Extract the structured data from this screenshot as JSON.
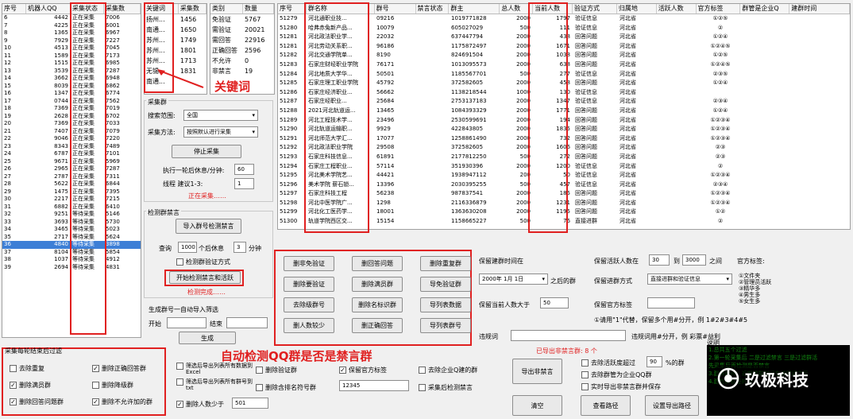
{
  "left_table": {
    "headers": [
      "序号",
      "机器人QQ",
      "采集状态",
      "采集数"
    ],
    "rows": [
      [
        "6",
        "4442",
        "正在采集",
        "7006"
      ],
      [
        "7",
        "4225",
        "正在采集",
        "6001"
      ],
      [
        "8",
        "1365",
        "正在采集",
        "6967"
      ],
      [
        "9",
        "7929",
        "正在采集",
        "7227"
      ],
      [
        "10",
        "4513",
        "正在采集",
        "7045"
      ],
      [
        "11",
        "1589",
        "正在采集",
        "7173"
      ],
      [
        "12",
        "1515",
        "正在采集",
        "6985"
      ],
      [
        "13",
        "3539",
        "正在采集",
        "7287"
      ],
      [
        "14",
        "3662",
        "正在采集",
        "6948"
      ],
      [
        "15",
        "8039",
        "正在采集",
        "6862"
      ],
      [
        "16",
        "1347",
        "正在采集",
        "6774"
      ],
      [
        "17",
        "0744",
        "正在采集",
        "7562"
      ],
      [
        "18",
        "7369",
        "正在采集",
        "7019"
      ],
      [
        "19",
        "2628",
        "正在采集",
        "6702"
      ],
      [
        "20",
        "7369",
        "正在采集",
        "7033"
      ],
      [
        "21",
        "7407",
        "正在采集",
        "7079"
      ],
      [
        "22",
        "9046",
        "正在采集",
        "7220"
      ],
      [
        "23",
        "8343",
        "正在采集",
        "7489"
      ],
      [
        "24",
        "6787",
        "正在采集",
        "7101"
      ],
      [
        "25",
        "9671",
        "正在采集",
        "5969"
      ],
      [
        "26",
        "2965",
        "正在采集",
        "7287"
      ],
      [
        "27",
        "2787",
        "正在采集",
        "7311"
      ],
      [
        "28",
        "5622",
        "正在采集",
        "6844"
      ],
      [
        "29",
        "1475",
        "正在采集",
        "7395"
      ],
      [
        "30",
        "2217",
        "正在采集",
        "7215"
      ],
      [
        "31",
        "6882",
        "正在采集",
        "6410"
      ],
      [
        "32",
        "9251",
        "等待采集",
        "5146"
      ],
      [
        "33",
        "3693",
        "等待采集",
        "5730"
      ],
      [
        "34",
        "3465",
        "等待采集",
        "5023"
      ],
      [
        "35",
        "2717",
        "等待采集",
        "5624"
      ],
      [
        "36",
        "4840",
        "等待采集",
        "3898"
      ],
      [
        "37",
        "8104",
        "等待采集",
        "5854"
      ],
      [
        "38",
        "1037",
        "等待采集",
        "4912"
      ],
      [
        "39",
        "2694",
        "等待采集",
        "4831"
      ]
    ]
  },
  "kw_table": {
    "headers": [
      "关键词",
      "采集数"
    ],
    "rows": [
      [
        "扬州...",
        "1456"
      ],
      [
        "南通...",
        "1650"
      ],
      [
        "苏州...",
        "1749"
      ],
      [
        "苏州...",
        "1801"
      ],
      [
        "苏州...",
        "1713"
      ],
      [
        "无锡...",
        "1831"
      ],
      [
        "南通...",
        ""
      ]
    ]
  },
  "cat_table": {
    "headers": [
      "类别",
      "数量"
    ],
    "rows": [
      [
        "免验证",
        "5767"
      ],
      [
        "需验证",
        "20021"
      ],
      [
        "需回答",
        "22916"
      ],
      [
        "正确回答",
        "2596"
      ],
      [
        "不允许",
        "0"
      ],
      [
        "非禁言",
        "19"
      ]
    ]
  },
  "annot": {
    "keyword": "关键词",
    "auto_detect": "自动检测QQ群是否是禁言群"
  },
  "collect": {
    "title": "采集群",
    "range_label": "搜索范围:",
    "range_value": "全国",
    "method_label": "采集方法:",
    "method_value": "按照默认进行采集",
    "stop_btn": "停止采集",
    "rest_label": "执行一轮后休息/分钟:",
    "rest_value": "60",
    "thread_label": "线程 建议1-3:",
    "thread_value": "1",
    "status": "正在采集……"
  },
  "detect": {
    "title": "检测群禁言",
    "import_btn": "导入群号检测禁言",
    "query_label": "查询",
    "query_value": "1000",
    "per_label": "个后休息",
    "rest_value": "3",
    "min_label": "分钟",
    "verify_cb": "检测群验证方式",
    "start_btn": "开始检测禁言和活跃",
    "status": "检测完成……"
  },
  "gen": {
    "title": "生成群号一自动导入筛选",
    "start_label": "开始",
    "end_label": "结束",
    "gen_btn": "生成"
  },
  "main_table": {
    "headers": [
      "序号",
      "群名称",
      "群号",
      "禁言状态",
      "群主",
      "总人数",
      "当前人数",
      "验证方式",
      "归属地",
      "活跃人数",
      "官方标签",
      "群管是企业Q",
      "建群时间"
    ],
    "rows": [
      [
        "51279",
        "河北通职业技...",
        "09216",
        "",
        "1019771828",
        "2000",
        "1797",
        "验证信息",
        "河北省",
        "",
        "①②⑤",
        ""
      ],
      [
        "51280",
        "哈弗赤兔新产品...",
        "10079",
        "",
        "605027029",
        "500",
        "111",
        "验证信息",
        "河北省",
        "",
        "②",
        ""
      ],
      [
        "51281",
        "河北政法职业学...",
        "22032",
        "",
        "637447794",
        "2000",
        "438",
        "回答问题",
        "河北省",
        "",
        "①②④",
        ""
      ],
      [
        "51281",
        "河北劳动关系职...",
        "96186",
        "",
        "1175872497",
        "2000",
        "1671",
        "回答问题",
        "河北省",
        "",
        "①②④⑤",
        ""
      ],
      [
        "51282",
        "河北交通学院单...",
        "8190",
        "",
        "824691504",
        "2000",
        "1038",
        "回答问题",
        "河北省",
        "",
        "①②⑤",
        ""
      ],
      [
        "51283",
        "石家庄财经职业学院",
        "76171",
        "",
        "1013095573",
        "2000",
        "638",
        "回答问题",
        "河北省",
        "",
        "①②④⑤",
        ""
      ],
      [
        "51284",
        "河北地质大学华...",
        "50501",
        "",
        "1185567701",
        "500",
        "277",
        "验证信息",
        "河北省",
        "",
        "②③⑤",
        ""
      ],
      [
        "51285",
        "石家庄理工职业学院",
        "45792",
        "",
        "372582605",
        "2000",
        "458",
        "回答问题",
        "河北省",
        "",
        "①②④",
        ""
      ],
      [
        "51286",
        "石家庄经济职业...",
        "56662",
        "",
        "1138218544",
        "1000",
        "130",
        "验证信息",
        "河北省",
        "",
        "",
        ""
      ],
      [
        "51287",
        "石家庄经职业...",
        "25684",
        "",
        "2753137183",
        "2000",
        "1347",
        "验证信息",
        "河北省",
        "",
        "②③④",
        ""
      ],
      [
        "51288",
        "2021河北轨道运...",
        "13465",
        "",
        "1084393329",
        "2000",
        "1771",
        "回答问题",
        "河北省",
        "",
        "①②④",
        ""
      ],
      [
        "51289",
        "河北工程技术学...",
        "23496",
        "",
        "2530599691",
        "2000",
        "194",
        "回答问题",
        "河北省",
        "",
        "①②③④",
        ""
      ],
      [
        "51290",
        "河北轨道运输职...",
        "9929",
        "",
        "422843805",
        "2000",
        "1835",
        "回答问题",
        "河北省",
        "",
        "①②③④",
        ""
      ],
      [
        "51291",
        "河北师范大学汇...",
        "17077",
        "",
        "1258861490",
        "2000",
        "732",
        "回答问题",
        "河北省",
        "",
        "①②③④",
        ""
      ],
      [
        "51292",
        "河北政法职业学院",
        "29508",
        "",
        "372582605",
        "2000",
        "1606",
        "回答问题",
        "河北省",
        "",
        "②③",
        ""
      ],
      [
        "51293",
        "石家庄科技信息...",
        "61891",
        "",
        "2177812250",
        "500",
        "272",
        "回答问题",
        "河北省",
        "",
        "②③",
        ""
      ],
      [
        "51294",
        "石家庄工程职业...",
        "57114",
        "",
        "351930396",
        "2000",
        "1200",
        "验证信息",
        "河北省",
        "",
        "②",
        ""
      ],
      [
        "51295",
        "河北美术学院艺...",
        "44421",
        "",
        "1938947112",
        "200",
        "50",
        "验证信息",
        "河北省",
        "",
        "①②③④",
        ""
      ],
      [
        "51296",
        "美术学院 薪石锁...",
        "13396",
        "",
        "2030395255",
        "500",
        "457",
        "验证信息",
        "河北省",
        "",
        "②③④",
        ""
      ],
      [
        "51297",
        "石家庄科技工程",
        "56238",
        "",
        "987837541",
        "2000",
        "185",
        "回答问题",
        "河北省",
        "",
        "①②③④",
        ""
      ],
      [
        "51298",
        "河北中医学院广...",
        "1298",
        "",
        "2116336879",
        "2000",
        "1231",
        "回答问题",
        "河北省",
        "",
        "①②③④",
        ""
      ],
      [
        "51299",
        "河北化工医药学...",
        "18001",
        "",
        "1363630208",
        "2000",
        "1195",
        "回答问题",
        "河北省",
        "",
        "①②",
        ""
      ],
      [
        "51300",
        "轨道学院西区交...",
        "15154",
        "",
        "1158665227",
        "500",
        "76",
        "直接进群",
        "河北省",
        "",
        "②",
        ""
      ]
    ]
  },
  "grid_btns": [
    "删非免验证",
    "删回答问题",
    "删除重复群",
    "删除要验证",
    "删除满员群",
    "导免验证群",
    "去除级群号",
    "删除名标识群",
    "导列表数据",
    "删人数较少",
    "删正确回答",
    "导列表群号"
  ],
  "filter": {
    "build_time_label": "保留建群时间在",
    "date_value": "2000年 1月 1日",
    "after_label": "之后的群",
    "method_label": "保留进群方式",
    "method_value": "直接进群和验证信息",
    "count_label": "保留当前人数大于",
    "count_value": "50",
    "active_label": "保留活跃人数在",
    "active_min": "30",
    "to_label": "到",
    "active_max": "3000",
    "between_label": "之间",
    "official_label": "官方标签:",
    "official_tag_label": "保留官方标签",
    "hint": "①请用\"1\"代替，保留多个用#分开，例 1#2#3#4#5",
    "kw_label": "违规词",
    "kw_hint": "违规词用#分开，例 彩票#益利",
    "exported": "已导出非禁言群: 8 个",
    "export_btn": "导出非禁言",
    "clear_btn": "清空",
    "view_btn": "查看路径",
    "path_btn": "设置导出路径",
    "official_opts": [
      "①文件夹",
      "②管理员活跃",
      "③精华多",
      "④男生多",
      "⑤女生多"
    ],
    "active_cb": "去除活跃度超过",
    "active_val": "90",
    "percent": "%的群",
    "admin_cb": "去除群管为企业QQ群",
    "realtime_cb": "实时导出非禁言群并保存",
    "explain": "说明"
  },
  "bottom": {
    "title": "采集每轮结束后过滤",
    "cbs": [
      [
        "去除重复",
        false
      ],
      [
        "删除正确回答群",
        true
      ],
      [
        "删除满员群",
        true
      ],
      [
        "删除降级群",
        false
      ],
      [
        "删除回答问题群",
        true
      ],
      [
        "删除不允许加的群",
        true
      ]
    ],
    "mid_cbs": [
      "筛选后导出列表所有数据到Excel",
      "筛选后导出列表所有群号到txt",
      "删除人数少于"
    ],
    "mid_val": "501",
    "right_cbs": [
      "删除验证群",
      "删除含排名符号群"
    ],
    "tag_cb": "保留官方标签",
    "tag_val": "12345",
    "corp_cb": "去除企业Q建的群",
    "after_cb": "采集后检测禁言"
  },
  "brand": {
    "name": "玖极科技",
    "black_text": "1.总共五个过滤\n2.第一轮采集后 二是过滤禁言 三是过滤群活\n先采集后再检测是否禁言\n3.建群时间：近期建群时间在该时间之后\n4.建有群标签的群"
  }
}
